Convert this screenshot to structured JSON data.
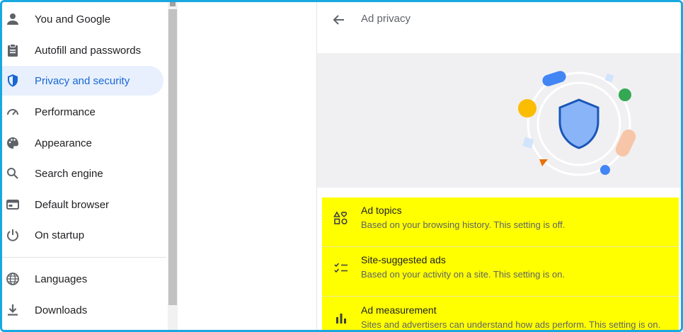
{
  "sidebar": {
    "items": [
      {
        "label": "You and Google",
        "icon": "person-icon"
      },
      {
        "label": "Autofill and passwords",
        "icon": "clipboard-icon"
      },
      {
        "label": "Privacy and security",
        "icon": "shield-icon",
        "active": true
      },
      {
        "label": "Performance",
        "icon": "speedometer-icon"
      },
      {
        "label": "Appearance",
        "icon": "palette-icon"
      },
      {
        "label": "Search engine",
        "icon": "search-icon"
      },
      {
        "label": "Default browser",
        "icon": "browser-icon"
      },
      {
        "label": "On startup",
        "icon": "power-icon"
      },
      {
        "label": "Languages",
        "icon": "globe-icon"
      },
      {
        "label": "Downloads",
        "icon": "download-icon"
      }
    ]
  },
  "main": {
    "title": "Ad privacy",
    "rows": [
      {
        "title": "Ad topics",
        "subtitle": "Based on your browsing history. This setting is off.",
        "icon": "shapes-icon"
      },
      {
        "title": "Site-suggested ads",
        "subtitle": "Based on your activity on a site. This setting is on.",
        "icon": "checklist-icon"
      },
      {
        "title": "Ad measurement",
        "subtitle": "Sites and advertisers can understand how ads perform. This setting is on.",
        "icon": "bar-chart-icon"
      }
    ]
  },
  "colors": {
    "accent": "#1967d2",
    "active_bg": "#e8f0fe",
    "highlight": "#ffff00",
    "frame_border": "#18a8e0"
  }
}
